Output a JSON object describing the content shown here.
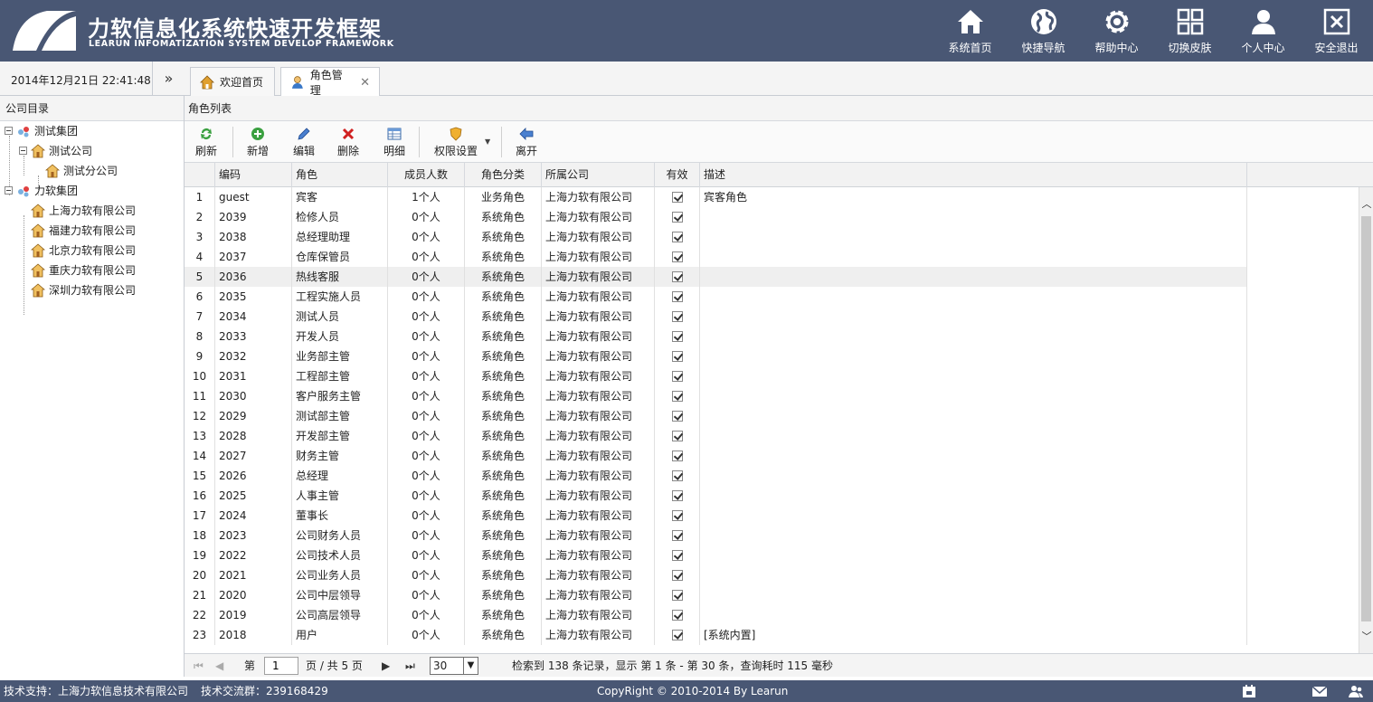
{
  "header": {
    "title": "力软信息化系统快速开发框架",
    "subtitle": "LEARUN INFOMATIZATION SYSTEM DEVELOP FRAMEWORK",
    "nav": [
      {
        "label": "系统首页",
        "icon": "home-icon"
      },
      {
        "label": "快捷导航",
        "icon": "globe-icon"
      },
      {
        "label": "帮助中心",
        "icon": "gear-icon"
      },
      {
        "label": "切换皮肤",
        "icon": "grid-icon"
      },
      {
        "label": "个人中心",
        "icon": "user-icon"
      },
      {
        "label": "安全退出",
        "icon": "exit-icon"
      }
    ]
  },
  "datetime": "2014年12月21日 22:41:48",
  "collapse_glyph": "»",
  "tabs": [
    {
      "label": "欢迎首页",
      "active": false
    },
    {
      "label": "角色管理",
      "active": true
    }
  ],
  "tab_close": "✕",
  "tree": {
    "title": "公司目录",
    "nodes": [
      {
        "label": "测试集团"
      },
      {
        "label": "测试公司"
      },
      {
        "label": "测试分公司"
      },
      {
        "label": "力软集团"
      },
      {
        "label": "上海力软有限公司"
      },
      {
        "label": "福建力软有限公司"
      },
      {
        "label": "北京力软有限公司"
      },
      {
        "label": "重庆力软有限公司"
      },
      {
        "label": "深圳力软有限公司"
      }
    ]
  },
  "main": {
    "section_title": "角色列表",
    "toolbar": [
      "刷新",
      "新增",
      "编辑",
      "删除",
      "明细",
      "权限设置",
      "离开"
    ]
  },
  "grid": {
    "columns": [
      "编码",
      "角色",
      "成员人数",
      "角色分类",
      "所属公司",
      "有效",
      "描述"
    ],
    "rows": [
      [
        "1",
        "guest",
        "宾客",
        "1个人",
        "业务角色",
        "上海力软有限公司",
        "宾客角色"
      ],
      [
        "2",
        "2039",
        "检修人员",
        "0个人",
        "系统角色",
        "上海力软有限公司",
        ""
      ],
      [
        "3",
        "2038",
        "总经理助理",
        "0个人",
        "系统角色",
        "上海力软有限公司",
        ""
      ],
      [
        "4",
        "2037",
        "仓库保管员",
        "0个人",
        "系统角色",
        "上海力软有限公司",
        ""
      ],
      [
        "5",
        "2036",
        "热线客服",
        "0个人",
        "系统角色",
        "上海力软有限公司",
        ""
      ],
      [
        "6",
        "2035",
        "工程实施人员",
        "0个人",
        "系统角色",
        "上海力软有限公司",
        ""
      ],
      [
        "7",
        "2034",
        "测试人员",
        "0个人",
        "系统角色",
        "上海力软有限公司",
        ""
      ],
      [
        "8",
        "2033",
        "开发人员",
        "0个人",
        "系统角色",
        "上海力软有限公司",
        ""
      ],
      [
        "9",
        "2032",
        "业务部主管",
        "0个人",
        "系统角色",
        "上海力软有限公司",
        ""
      ],
      [
        "10",
        "2031",
        "工程部主管",
        "0个人",
        "系统角色",
        "上海力软有限公司",
        ""
      ],
      [
        "11",
        "2030",
        "客户服务主管",
        "0个人",
        "系统角色",
        "上海力软有限公司",
        ""
      ],
      [
        "12",
        "2029",
        "测试部主管",
        "0个人",
        "系统角色",
        "上海力软有限公司",
        ""
      ],
      [
        "13",
        "2028",
        "开发部主管",
        "0个人",
        "系统角色",
        "上海力软有限公司",
        ""
      ],
      [
        "14",
        "2027",
        "财务主管",
        "0个人",
        "系统角色",
        "上海力软有限公司",
        ""
      ],
      [
        "15",
        "2026",
        "总经理",
        "0个人",
        "系统角色",
        "上海力软有限公司",
        ""
      ],
      [
        "16",
        "2025",
        "人事主管",
        "0个人",
        "系统角色",
        "上海力软有限公司",
        ""
      ],
      [
        "17",
        "2024",
        "董事长",
        "0个人",
        "系统角色",
        "上海力软有限公司",
        ""
      ],
      [
        "18",
        "2023",
        "公司财务人员",
        "0个人",
        "系统角色",
        "上海力软有限公司",
        ""
      ],
      [
        "19",
        "2022",
        "公司技术人员",
        "0个人",
        "系统角色",
        "上海力软有限公司",
        ""
      ],
      [
        "20",
        "2021",
        "公司业务人员",
        "0个人",
        "系统角色",
        "上海力软有限公司",
        ""
      ],
      [
        "21",
        "2020",
        "公司中层领导",
        "0个人",
        "系统角色",
        "上海力软有限公司",
        ""
      ],
      [
        "22",
        "2019",
        "公司高层领导",
        "0个人",
        "系统角色",
        "上海力软有限公司",
        ""
      ],
      [
        "23",
        "2018",
        "用户",
        "0个人",
        "系统角色",
        "上海力软有限公司",
        "[系统内置]"
      ]
    ],
    "highlight_row": 5
  },
  "pager": {
    "page_prefix": "第",
    "page_value": "1",
    "page_suffix": "页 / 共 5 页",
    "page_size": "30",
    "summary": "检索到 138 条记录，显示 第 1 条 - 第 30 条，查询耗时 115 毫秒"
  },
  "footer": {
    "support": "技术支持：上海力软信息技术有限公司",
    "group": "技术交流群：239168429",
    "copyright": "CopyRight © 2010-2014 By Learun"
  },
  "colors": {
    "header_bg": "#495774",
    "accent": "#495774"
  }
}
